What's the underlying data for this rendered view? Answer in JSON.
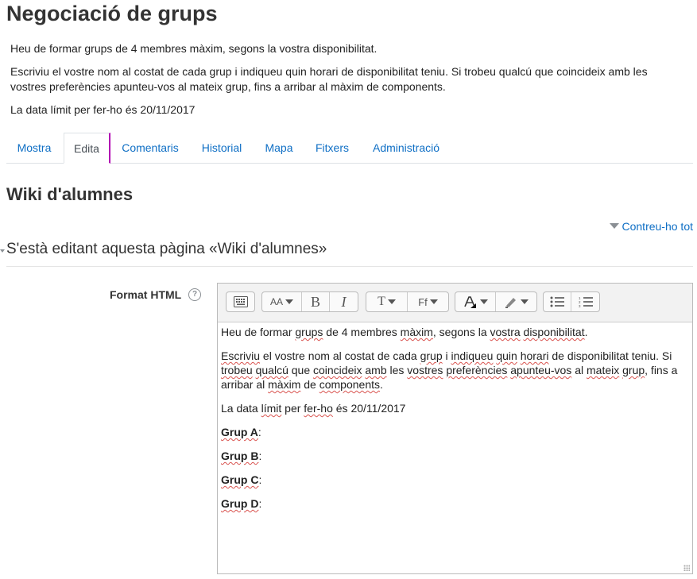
{
  "page": {
    "title": "Negociació de grups"
  },
  "intro": {
    "p1": "Heu de formar grups de 4 membres màxim, segons la vostra disponibilitat.",
    "p2": "Escriviu el vostre nom al costat de cada grup i indiqueu quin horari de disponibilitat teniu. Si trobeu qualcú que coincideix amb les vostres preferències apunteu-vos al mateix grup, fins a arribar al màxim de components.",
    "p3": "La data límit per fer-ho és 20/11/2017"
  },
  "tabs": [
    {
      "label": "Mostra",
      "active": false
    },
    {
      "label": "Edita",
      "active": true
    },
    {
      "label": "Comentaris",
      "active": false
    },
    {
      "label": "Historial",
      "active": false
    },
    {
      "label": "Mapa",
      "active": false
    },
    {
      "label": "Fitxers",
      "active": false
    },
    {
      "label": "Administració",
      "active": false
    }
  ],
  "wiki": {
    "title": "Wiki d'alumnes"
  },
  "collapse_all": "Contreu-ho tot",
  "editing": {
    "legend": "S'està editant aquesta pàgina «Wiki d'alumnes»"
  },
  "form": {
    "label": "Format HTML",
    "help_symbol": "?"
  },
  "toolbar": {
    "font_size_glyph": "AA",
    "bold_glyph": "B",
    "italic_glyph": "I",
    "heading_glyph": "T",
    "font_glyph": "Ff"
  },
  "editor": {
    "line1_parts": [
      "Heu de formar ",
      "grups",
      " de 4 membres ",
      "màxim",
      ", segons la ",
      "vostra",
      " ",
      "disponibilitat",
      "."
    ],
    "line2_parts": [
      "Escriviu",
      " el vostre nom al costat de cada ",
      "grup",
      " i ",
      "indiqueu",
      " ",
      "quin",
      " ",
      "horari",
      " de disponibilitat teniu. Si ",
      "trobeu",
      " ",
      "qualcú",
      " que ",
      "coincideix",
      " ",
      "amb",
      " les ",
      "vostres",
      " ",
      "preferències",
      " ",
      "apunteu-vos",
      " al ",
      "mateix",
      " ",
      "grup",
      ", fins a arribar al ",
      "màxim",
      " de ",
      "components",
      "."
    ],
    "line3_parts": [
      "La data ",
      "límit",
      " per ",
      "fer-ho",
      " és 20/11/2017"
    ],
    "groups": [
      {
        "label": "Grup A",
        "suffix": ":"
      },
      {
        "label": "Grup B",
        "suffix": ":"
      },
      {
        "label": "Grup C",
        "suffix": ":"
      },
      {
        "label": "Grup D",
        "suffix": ":"
      }
    ]
  },
  "colors": {
    "link": "#0f6fc5",
    "active_tab_accent": "#b100b3",
    "spell_error": "#d9534f"
  }
}
